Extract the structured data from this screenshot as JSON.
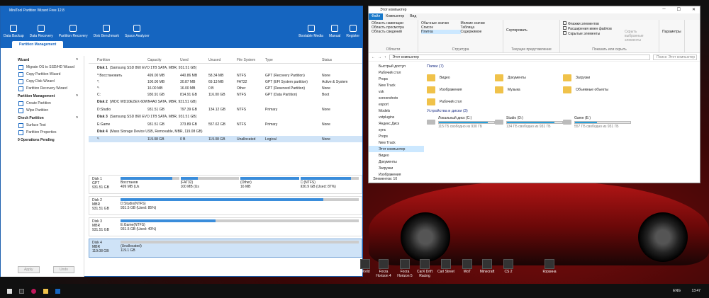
{
  "minitool": {
    "title": "MiniTool Partition Wizard Free 12.8",
    "toolbar": [
      "Data Backup",
      "Data Recovery",
      "Partition Recovery",
      "Disk Benchmark",
      "Space Analyzer"
    ],
    "toolbar_right": [
      "Bootable Media",
      "Manual",
      "Register"
    ],
    "tab": "Partition Management",
    "wizard_title": "Wizard",
    "wizard": [
      "Migrate OS to SSD/HD Wizard",
      "Copy Partition Wizard",
      "Copy Disk Wizard",
      "Partition Recovery Wizard"
    ],
    "pm_title": "Partition Management",
    "pm": [
      "Create Partition",
      "Wipe Partition"
    ],
    "cp_title": "Check Partition",
    "cp": [
      "Surface Test",
      "Partition Properties"
    ],
    "ops": "0 Operations Pending",
    "apply": "Apply",
    "undo": "Undo",
    "cols": [
      "Partition",
      "Capacity",
      "Used",
      "Unused",
      "File System",
      "Type",
      "Status"
    ],
    "disks": [
      {
        "head": "Disk 1",
        "desc": "(Samsung SSD 860 EVO 1TB SATA, MBR, 931.51 GB)",
        "rows": [
          [
            "*:Восстановить",
            "499.00 MB",
            "440.86 MB",
            "58.34 MB",
            "NTFS",
            "GPT (Recovery Partition)",
            "None"
          ],
          [
            "*:",
            "100.00 MB",
            "30.87 MB",
            "69.13 MB",
            "FAT32",
            "GPT (EFI System partition)",
            "Active & System"
          ],
          [
            "*:",
            "16.00 MB",
            "16.00 MB",
            "0 B",
            "Other",
            "GPT (Reserved Partition)",
            "None"
          ],
          [
            "C:",
            "930.91 GB",
            "814.91 GB",
            "116.00 GB",
            "NTFS",
            "GPT (Data Partition)",
            "Boot"
          ]
        ]
      },
      {
        "head": "Disk 2",
        "desc": "(WDC WD10EZEX-60WN4A0 SATA, MBR, 931.51 GB)",
        "rows": [
          [
            "D:Studio",
            "931.51 GB",
            "797.39 GB",
            "134.12 GB",
            "NTFS",
            "Primary",
            "None"
          ]
        ]
      },
      {
        "head": "Disk 3",
        "desc": "(Samsung SSD 860 EVO 1TB SATA, MBR, 931.51 GB)",
        "rows": [
          [
            "E:Game",
            "931.51 GB",
            "373.89 GB",
            "557.62 GB",
            "NTFS",
            "Primary",
            "None"
          ]
        ]
      },
      {
        "head": "Disk 4",
        "desc": "(Mass Storage Device USB, Removable, MBR, 119.08 GB)",
        "rows": [
          [
            "*:",
            "119.08 GB",
            "0 B",
            "119.08 GB",
            "Unallocated",
            "Logical",
            "None"
          ]
        ]
      }
    ],
    "map": [
      {
        "name": "Disk 1",
        "style": "GPT",
        "size": "931.51 GB",
        "segs": [
          [
            "Восстанов",
            "499 MB (Us"
          ],
          [
            "(FAT32)",
            "100 MB (Us"
          ],
          [
            "(Other)",
            "16 MB"
          ],
          [
            "C:(NTFS)",
            "930.9 GB (Used: 87%)"
          ]
        ]
      },
      {
        "name": "Disk 2",
        "style": "MBR",
        "size": "931.51 GB",
        "segs": [
          [
            "D:Studio(NTFS)",
            "931.5 GB (Used: 85%)"
          ]
        ]
      },
      {
        "name": "Disk 3",
        "style": "MBR",
        "size": "931.51 GB",
        "segs": [
          [
            "E:Game(NTFS)",
            "931.5 GB (Used: 40%)"
          ]
        ]
      },
      {
        "name": "Disk 4",
        "style": "MBR",
        "size": "119.08 GB",
        "segs": [
          [
            "(Unallocated)",
            "119.1 GB"
          ]
        ]
      }
    ]
  },
  "explorer": {
    "title": "Этот компьютер",
    "tabs": [
      "Файл",
      "Компьютер",
      "Вид"
    ],
    "ribbon": {
      "pane": [
        "Область навигации",
        "Область просмотра",
        "Область сведений"
      ],
      "layout": [
        "Обычные значки",
        "Мелкие значки",
        "Список",
        "Таблица",
        "Плитка",
        "Содержимое"
      ],
      "sort": "Сортировать",
      "show": [
        "Флажки элементов",
        "Расширения имен файлов",
        "Скрытые элементы"
      ],
      "hide": "Скрыть выбранные элементы",
      "params": "Параметры",
      "groups": [
        "Области",
        "Структура",
        "Текущее представление",
        "Показать или скрыть"
      ]
    },
    "address": "Этот компьютер",
    "search": "Поиск: Этот компьютер",
    "nav": [
      "Быстрый доступ",
      "Рабочий стол",
      "Props",
      "New Track",
      "vsk",
      "screenshoto",
      "export",
      "Models",
      "vstplugins",
      "Яндекс.Диск",
      "sync",
      "Props",
      "New Track",
      "Этот компьютер",
      "Видео",
      "Документы",
      "Загрузки",
      "Изображения"
    ],
    "folders_head": "Папки (7)",
    "folders": [
      "Видео",
      "Документы",
      "Загрузки",
      "Изображения",
      "Музыка",
      "Объемные объекты",
      "Рабочий стол"
    ],
    "drives_head": "Устройства и диски (3)",
    "drives": [
      {
        "name": "Локальный диск (C:)",
        "free": "115 ГБ свободно из 930 ГБ",
        "used": 0.88
      },
      {
        "name": "Studio (D:)",
        "free": "134 ГБ свободно из 931 ГБ",
        "used": 0.86
      },
      {
        "name": "Game (E:)",
        "free": "557 ГБ свободно из 931 ГБ",
        "used": 0.4
      }
    ],
    "status": "Элементов: 10"
  },
  "desktop_icons": [
    "World",
    "Forza Horizon 4",
    "Forza Horizon 5",
    "CarX Drift Racing",
    "Carl Street",
    "WoT",
    "Minecraft",
    "CS 2",
    "Корзина"
  ],
  "taskbar": {
    "lang": "ENG",
    "time": "13:47"
  }
}
